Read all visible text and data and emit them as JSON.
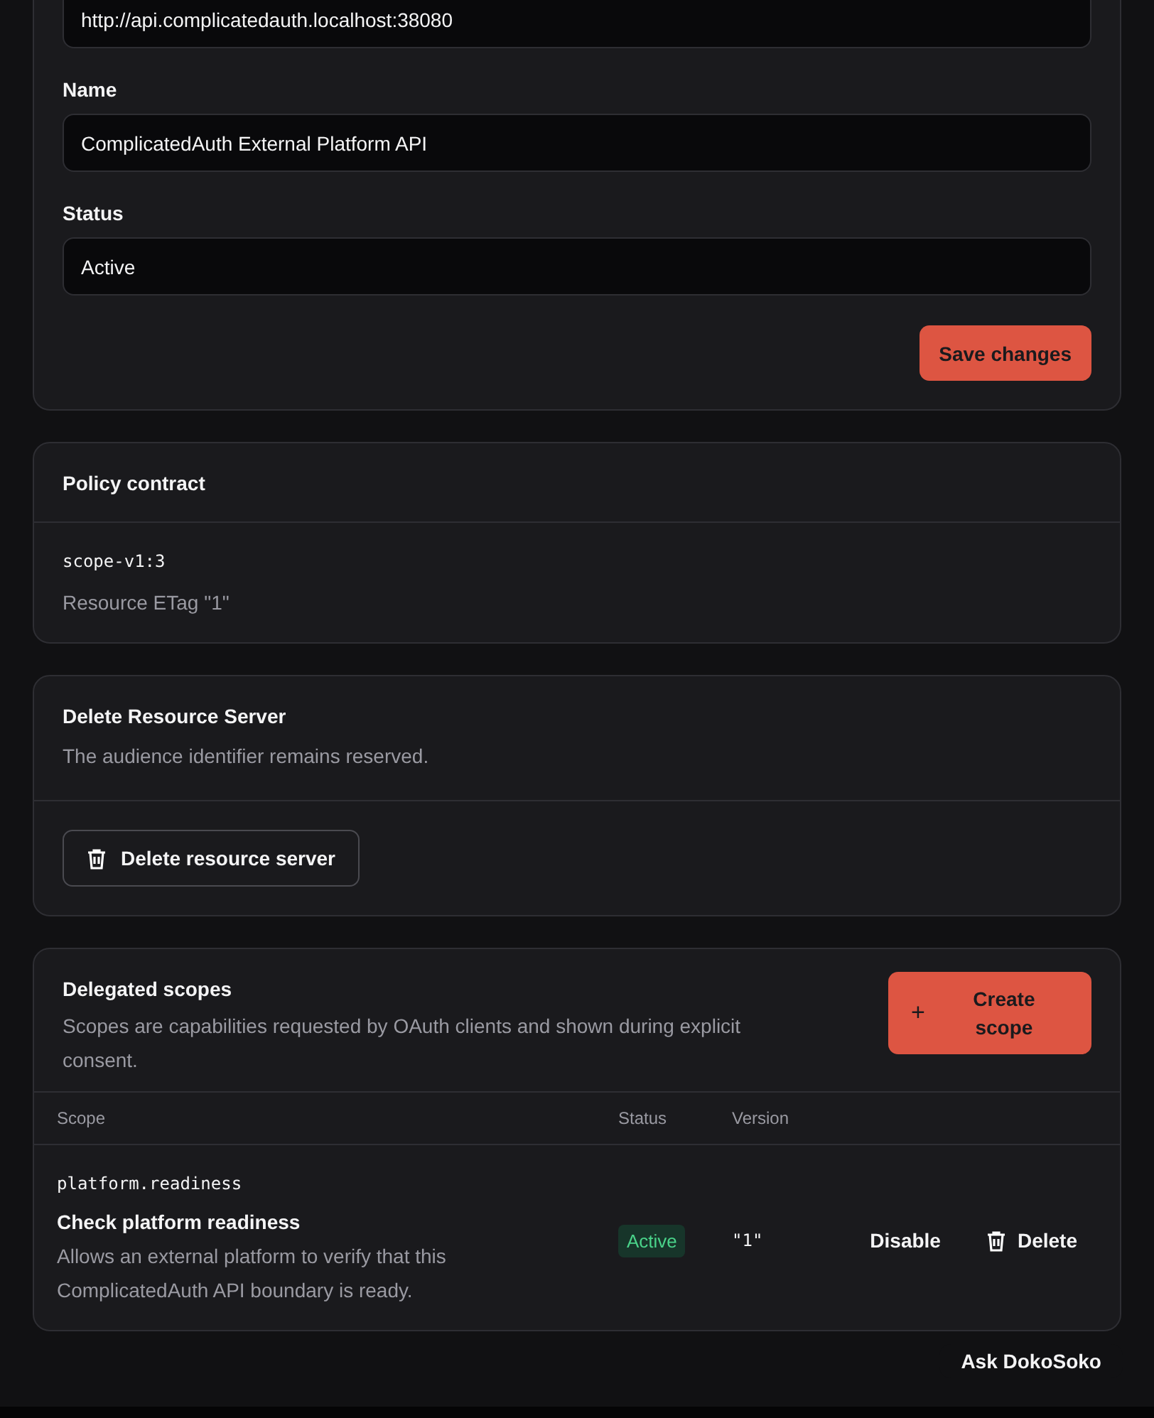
{
  "settings_form": {
    "fields": [
      {
        "value": "http://api.complicatedauth.localhost:38080"
      },
      {
        "label": "Name",
        "value": "ComplicatedAuth External Platform API"
      },
      {
        "label": "Status",
        "value": "Active"
      }
    ],
    "save_button": "Save changes"
  },
  "policy_contract": {
    "title": "Policy contract",
    "version": "scope-v1:3",
    "etag": "Resource ETag \"1\""
  },
  "delete_section": {
    "title": "Delete Resource Server",
    "description": "The audience identifier remains reserved.",
    "button": "Delete resource server"
  },
  "scopes": {
    "title": "Delegated scopes",
    "description": "Scopes are capabilities requested by OAuth clients and shown during explicit consent.",
    "create_button_icon": "+",
    "create_button": "Create scope",
    "columns": [
      "Scope",
      "Status",
      "Version"
    ],
    "rows": [
      {
        "key": "platform.readiness",
        "name": "Check platform readiness",
        "description": "Allows an external platform to verify that this ComplicatedAuth API boundary is ready.",
        "status": "Active",
        "version": "\"1\"",
        "toggle_action": "Disable",
        "delete_action": "Delete"
      }
    ]
  },
  "assistant_button": "Ask DokoSoko"
}
